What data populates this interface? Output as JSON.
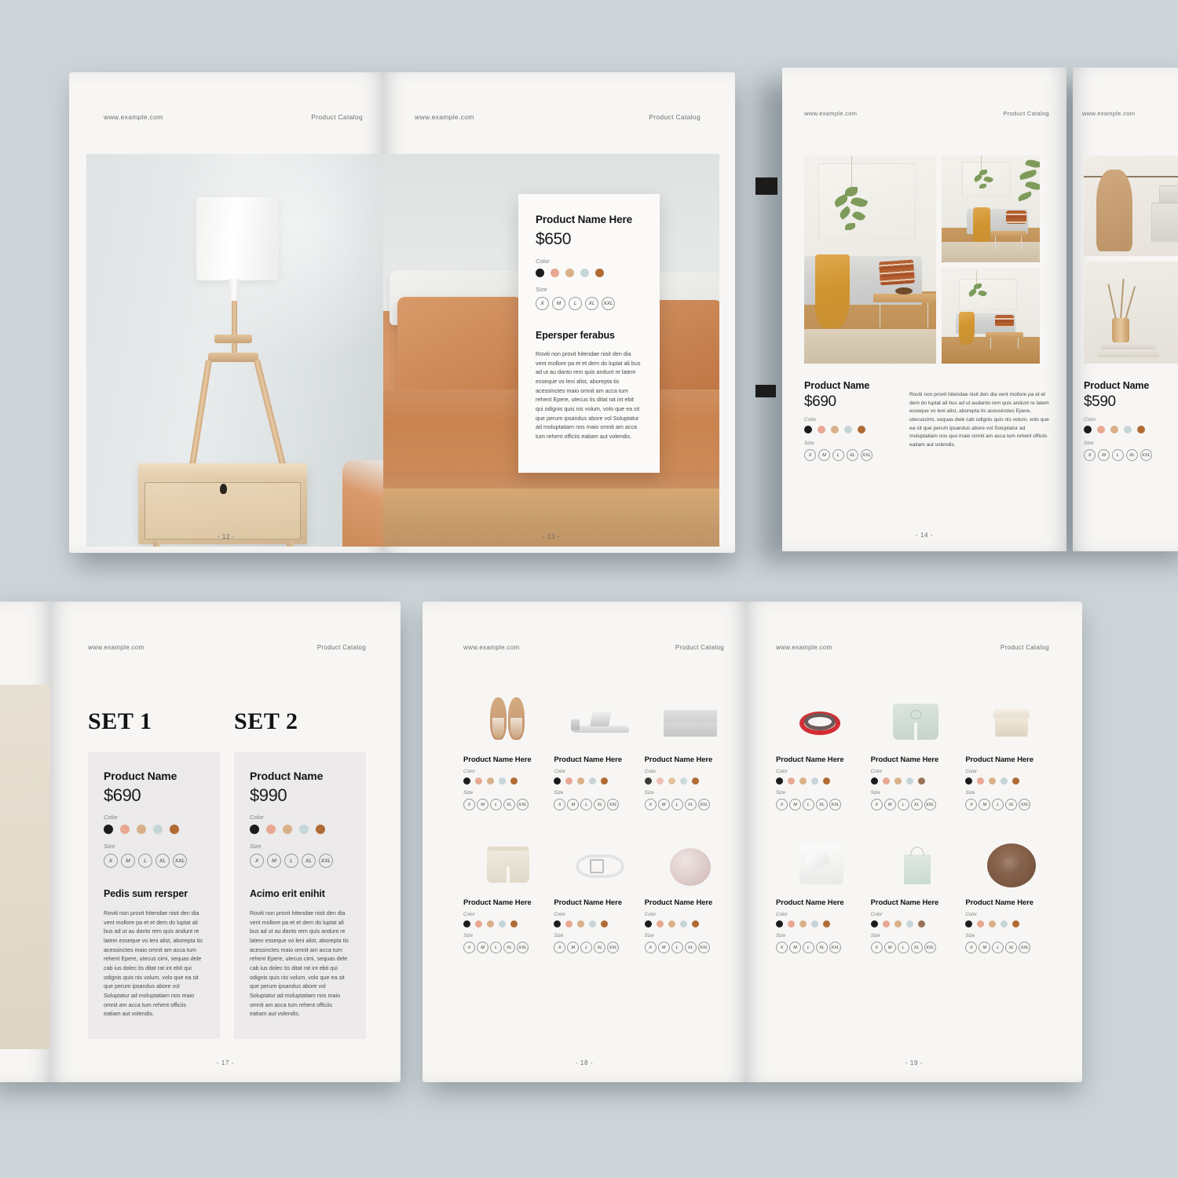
{
  "meta": {
    "background_color": "#ccd4d8",
    "page_color": "#f7f6f4",
    "accent_dark": "#141414"
  },
  "header": {
    "site": "www.example.com",
    "catalog": "Product Catalog"
  },
  "labels": {
    "color": "Color",
    "size": "Size"
  },
  "sizes": [
    "X",
    "M",
    "L",
    "XL",
    "XXL"
  ],
  "swatch_colors": [
    "#1c1c1c",
    "#e8a893",
    "#d9b089",
    "#c6d5d7",
    "#b06a33"
  ],
  "spreads": [
    {
      "id": "spread-12-13",
      "pages": [
        {
          "folio": "- 12 -",
          "kind": "full-bleed-photo",
          "photo": "bedside-lamp-on-wood-nightstand"
        },
        {
          "folio": "- 13 -",
          "kind": "photo-with-card",
          "photo": "terracotta-bedding-with-pillows",
          "card": {
            "title": "Product Name Here",
            "price": "$650",
            "section_heading": "Epersper ferabus",
            "body": "Roviti non provit hitendae nisit den dia vent mollore pa et et dem do luptat ali bus ad ut au danto rem quis andunt re latem esseque vo leni alist, aborepta tis acessinctes maio omnit am acca tum rehent Epere, utecus tis ditat rat int ebit qui odignis quis nis volum, volo que ea sit que perum ipsandus abore vol Soluptatur ad moluptatiam nos maio omnit am acca tum rehent officiis eatiam aut volendis."
          }
        }
      ]
    },
    {
      "id": "spread-14-15",
      "pages": [
        {
          "folio": "- 14 -",
          "kind": "photo-grid-with-product",
          "photos": [
            "living-room-with-hanging-plant-and-sofa",
            "living-room-wide-with-plant",
            "living-room-detail-coffee-table"
          ],
          "product": {
            "title": "Product Name",
            "price": "$690",
            "body": "Roviti non provit hitendae nisit den dia vent mollore pa et et dem do luptat ali bus ad ut audanto rem quis andunt re latem esseque vo leni alist, aborepta tis acessinctes Epere, utecuscimi, sequas dele cab odignis quis nis volum, volo que ea sit que perum ipsandus abore vol Soluptatur ad moluptatiam nos quo maio omnit am acca tum rehent officiis eatiam aut volendis."
          }
        },
        {
          "folio": "",
          "kind": "photo-grid-with-product-partial",
          "photos": [
            "hanging-robe-and-shelf",
            "reed-diffuser-with-books"
          ],
          "product": {
            "title": "Product Name",
            "price": "$590"
          }
        }
      ]
    },
    {
      "id": "spread-17",
      "pages": [
        {
          "folio": "",
          "kind": "partial-photo-page",
          "photo": "beige-texture-block"
        },
        {
          "folio": "- 17 -",
          "kind": "two-sets",
          "sets": [
            {
              "heading": "SET 1",
              "title": "Product Name",
              "price": "$690",
              "section_heading": "Pedis sum rersper",
              "body": "Roviti non provit hitendae nisit den dia vent mollore pa et et dem do luptat ali bus ad ut au danto rem quis andunt re latem esseque vo leni alist, aborepta tis acessinctes maio omnit am acca tum rehent Epere, utecus cimi, sequas dele cab ius dolec tis ditat rat int ebit qui odignis quis nis volum, volo que ea sit que perum ipsandus abore vol Soluptatur ad moluptatiam nos maio omnit am acca tum rehent officiis eatiam aut volendis."
            },
            {
              "heading": "SET 2",
              "title": "Product Name",
              "price": "$990",
              "section_heading": "Acimo erit enihit",
              "body": "Roviti non provit hitendae nisit den dia vent mollore pa et et dem do luptat ali bus ad ut au danto rem quis andunt re latem esseque vo leni alist, aborepta tis acessinctes maio omnit am acca tum rehent Epere, utecus cimi, sequas dele cab ius dolec tis ditat rat int ebit qui odignis quis nis volum, volo que ea sit que perum ipsandus abore vol Soluptatur ad moluptatiam nos maio omnit am acca tum rehent officiis eatiam aut volendis."
            }
          ]
        }
      ]
    },
    {
      "id": "spread-18-19",
      "pages": [
        {
          "folio": "- 18 -",
          "kind": "product-grid",
          "items": [
            {
              "name": "Product Name Here",
              "thumb": "tan-ballet-flats"
            },
            {
              "name": "Product Name Here",
              "thumb": "silver-slide-sandals"
            },
            {
              "name": "Product Name Here",
              "thumb": "silver-clutch-bag"
            },
            {
              "name": "Product Name Here",
              "thumb": "cream-denim-shorts"
            },
            {
              "name": "Product Name Here",
              "thumb": "white-leather-belt"
            },
            {
              "name": "Product Name Here",
              "thumb": "blush-silk-scarf"
            }
          ]
        },
        {
          "folio": "- 19 -",
          "kind": "product-grid",
          "items": [
            {
              "name": "Product Name Here",
              "thumb": "red-beaded-bracelet"
            },
            {
              "name": "Product Name Here",
              "thumb": "mint-ruffle-shorts"
            },
            {
              "name": "Product Name Here",
              "thumb": "cream-cosmetic-jar"
            },
            {
              "name": "Product Name Here",
              "thumb": "white-wrap-skirt"
            },
            {
              "name": "Product Name Here",
              "thumb": "mint-canvas-tote"
            },
            {
              "name": "Product Name Here",
              "thumb": "brown-felt-hat"
            }
          ]
        }
      ]
    }
  ]
}
